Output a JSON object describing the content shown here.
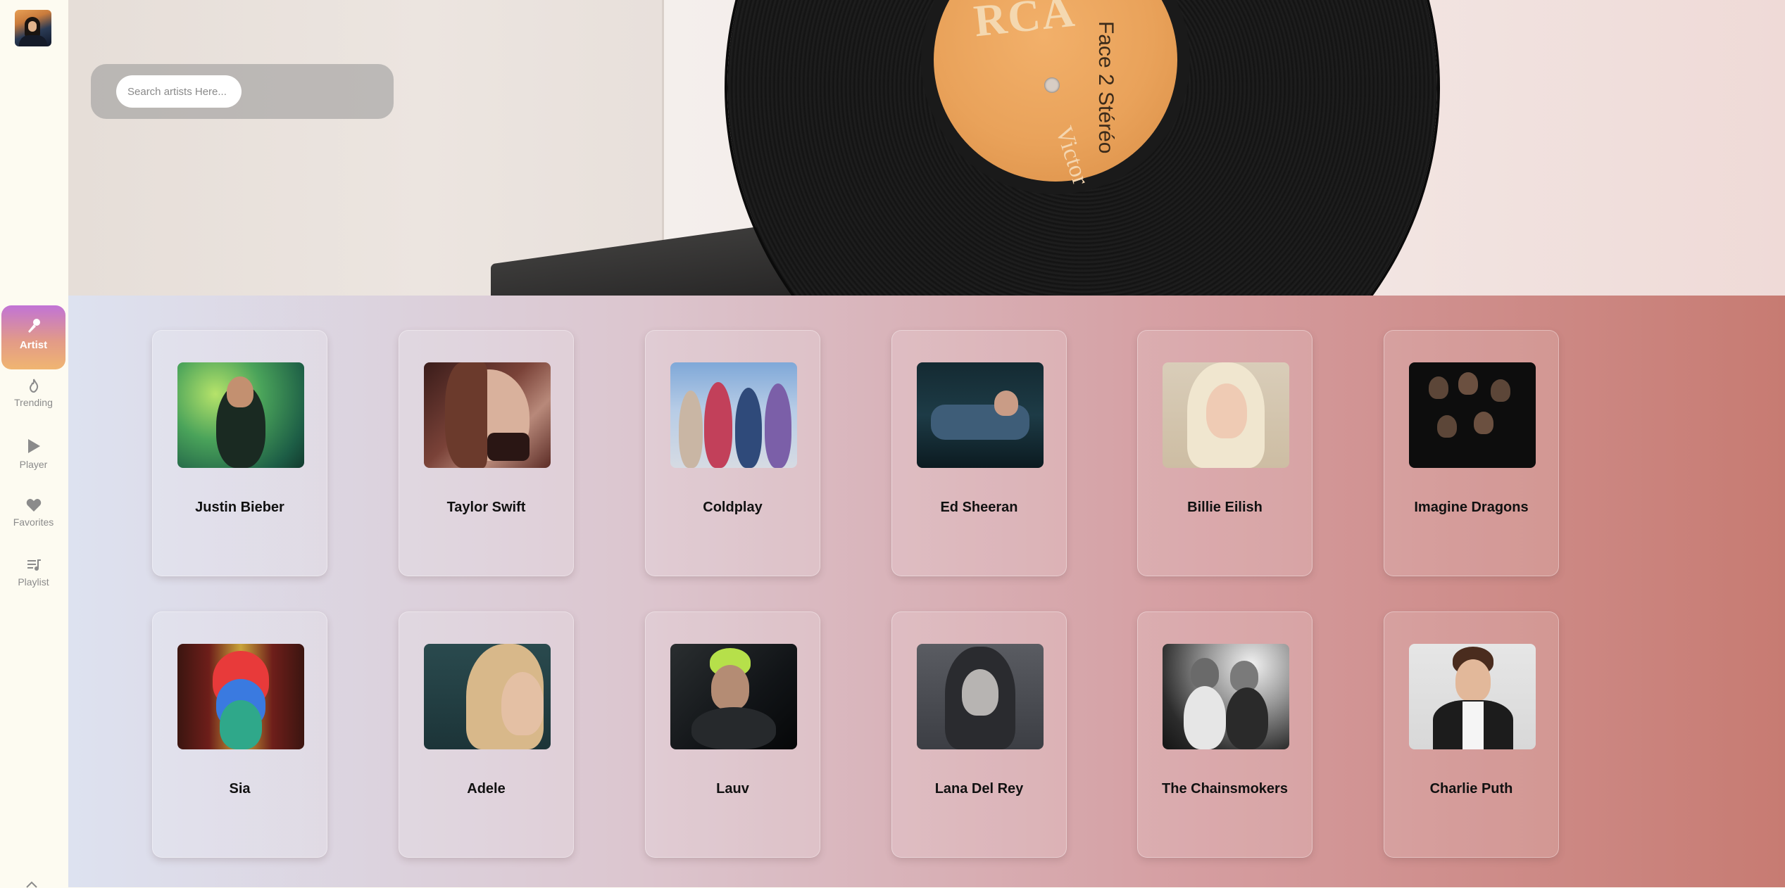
{
  "sidebar": {
    "avatar_icon": "user-avatar",
    "items": [
      {
        "label": "Artist",
        "icon": "microphone-icon",
        "active": true
      },
      {
        "label": "Trending",
        "icon": "flame-icon",
        "active": false
      },
      {
        "label": "Player",
        "icon": "play-icon",
        "active": false
      },
      {
        "label": "Favorites",
        "icon": "heart-icon",
        "active": false
      },
      {
        "label": "Playlist",
        "icon": "playlist-icon",
        "active": false
      }
    ]
  },
  "hero": {
    "search_placeholder": "Search artists Here...",
    "record_label_text": "RCA",
    "record_side_text": "Face 2 Stéréo",
    "record_brand_text": "Victor"
  },
  "artists": [
    {
      "name": "Justin Bieber"
    },
    {
      "name": "Taylor Swift"
    },
    {
      "name": "Coldplay"
    },
    {
      "name": "Ed Sheeran"
    },
    {
      "name": "Billie Eilish"
    },
    {
      "name": "Imagine Dragons"
    },
    {
      "name": "Sia"
    },
    {
      "name": "Adele"
    },
    {
      "name": "Lauv"
    },
    {
      "name": "Lana Del Rey"
    },
    {
      "name": "The Chainsmokers"
    },
    {
      "name": "Charlie Puth"
    }
  ],
  "colors": {
    "sidebar_bg": "#fdfbf1",
    "active_gradient_start": "#c173d6",
    "active_gradient_end": "#f0b571",
    "grid_gradient_start": "#dde2f0",
    "grid_gradient_end": "#c77b72"
  }
}
